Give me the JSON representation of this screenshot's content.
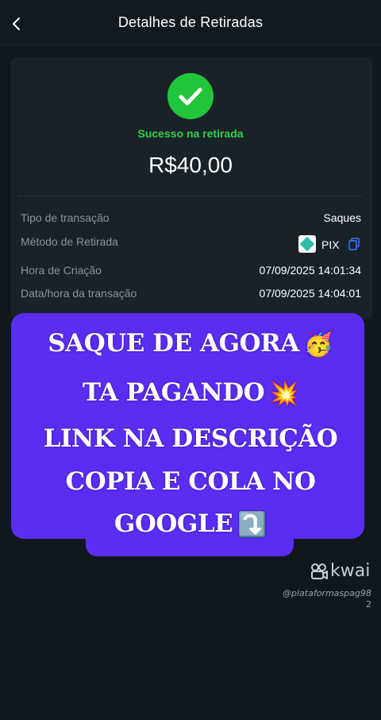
{
  "header": {
    "title": "Detalhes de Retiradas",
    "back_icon": "chevron-left-icon"
  },
  "status": {
    "icon": "checkmark-circle-icon",
    "text": "Sucesso na retirada",
    "color": "#22c53a"
  },
  "amount": "R$40,00",
  "details": {
    "transaction_type_label": "Tipo de transação",
    "transaction_type_value": "Saques",
    "method_label": "Método de Retirada",
    "method_value": "PIX",
    "method_icon": "pix-icon",
    "copy_icon": "copy-icon",
    "created_label": "Hora de Criação",
    "created_value": "07/09/2025 14:01:34",
    "transaction_time_label": "Data/hora da transação",
    "transaction_time_value": "07/09/2025 14:04:01"
  },
  "promo": {
    "line1": "SAQUE DE AGORA",
    "line1_emoji": "🥳",
    "line2": "TA PAGANDO",
    "line2_emoji": "💥",
    "line3": "LINK NA DESCRIÇÃO",
    "line4": "COPIA E COLA NO",
    "line5": "GOOGLE",
    "line5_emoji": "⤵️",
    "background": "#5b2df2"
  },
  "watermark": {
    "brand": "kwai",
    "logo_icon": "kwai-logo-icon",
    "user": "@plataformaspag98",
    "user_suffix": "2"
  }
}
